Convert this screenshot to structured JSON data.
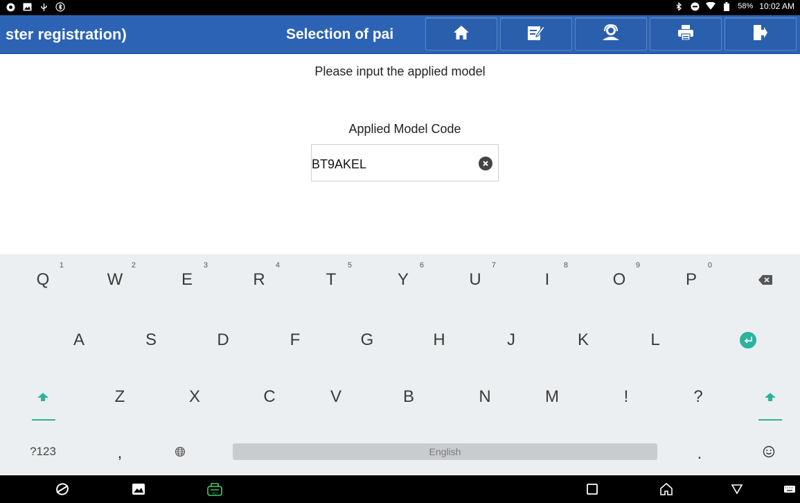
{
  "status_bar": {
    "left_icons": [
      "app-icon",
      "gallery-icon",
      "usb-icon",
      "bluetooth-icon"
    ],
    "right_icons": [
      "bluetooth-icon",
      "do-not-disturb-icon",
      "wifi-icon",
      "battery-icon"
    ],
    "battery": "58%",
    "time": "10:02 AM"
  },
  "toolbar": {
    "left_title": "ster registration)",
    "middle_title": "Selection of pai",
    "buttons": [
      "home-icon",
      "edit-icon",
      "support-icon",
      "print-icon",
      "exit-icon"
    ],
    "background": "#2c63b5"
  },
  "content": {
    "prompt": "Please input the applied model",
    "field_label": "Applied Model Code",
    "field_value": "BT9AKEL"
  },
  "keyboard": {
    "row1": [
      {
        "label": "Q",
        "hint": "1"
      },
      {
        "label": "W",
        "hint": "2"
      },
      {
        "label": "E",
        "hint": "3"
      },
      {
        "label": "R",
        "hint": "4"
      },
      {
        "label": "T",
        "hint": "5"
      },
      {
        "label": "Y",
        "hint": "6"
      },
      {
        "label": "U",
        "hint": "7"
      },
      {
        "label": "I",
        "hint": "8"
      },
      {
        "label": "O",
        "hint": "9"
      },
      {
        "label": "P",
        "hint": "0"
      }
    ],
    "row2": [
      "A",
      "S",
      "D",
      "F",
      "G",
      "H",
      "J",
      "K",
      "L"
    ],
    "row3": [
      "Z",
      "X",
      "C",
      "V",
      "B",
      "N",
      "M",
      "!",
      "?"
    ],
    "symbols_label": "?123",
    "comma_label": ",",
    "period_label": ".",
    "space_label": "English",
    "accent": "#2bb39c"
  },
  "nav_bar": {
    "icons": [
      "browser-icon",
      "gallery-icon",
      "vci-icon",
      "recents-icon",
      "home-icon",
      "back-icon",
      "keyboard-icon"
    ]
  }
}
